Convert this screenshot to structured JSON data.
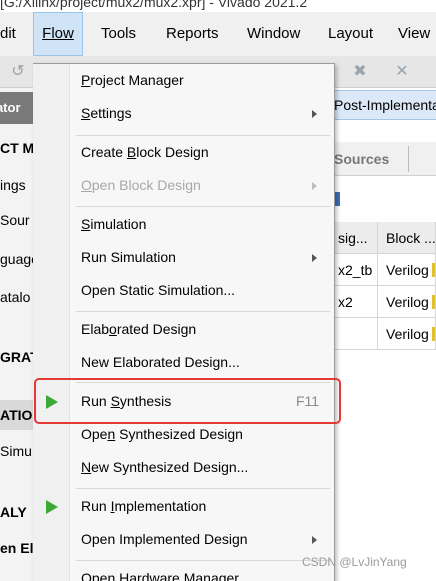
{
  "window": {
    "title": "[G:/Xilinx/project/mux2/mux2.xpr] - Vivado 2021.2"
  },
  "menubar": {
    "items": [
      {
        "label": "dit"
      },
      {
        "label": "Flow",
        "active": true
      },
      {
        "label": "Tools"
      },
      {
        "label": "Reports"
      },
      {
        "label": "Window"
      },
      {
        "label": "Layout"
      },
      {
        "label": "View"
      }
    ]
  },
  "left_panel": {
    "header": "gator",
    "lines": [
      "CT M",
      "ings",
      "Sour",
      "guage",
      "atalo",
      "GRAT",
      "ATIO",
      "Simu",
      "ALY",
      "en El"
    ]
  },
  "right_panel": {
    "banner": "Post-Implementation",
    "tab_label": "Sources",
    "table": {
      "headers": [
        "sig...",
        "Block ..."
      ],
      "rows": [
        [
          "x2_tb",
          "Verilog"
        ],
        [
          "x2",
          "Verilog"
        ],
        [
          "",
          "Verilog"
        ]
      ]
    }
  },
  "flow_menu": {
    "items": [
      {
        "id": "project-manager",
        "label": "Project Manager"
      },
      {
        "id": "settings",
        "label": "Settings",
        "submenu": true
      },
      {
        "id": "create-block-design",
        "label": "Create Block Design"
      },
      {
        "id": "open-block-design",
        "label": "Open Block Design",
        "disabled": true,
        "submenu": true
      },
      {
        "id": "simulation",
        "label": "Simulation"
      },
      {
        "id": "run-simulation",
        "label": "Run Simulation",
        "submenu": true
      },
      {
        "id": "open-static-simulation",
        "label": "Open Static Simulation..."
      },
      {
        "id": "elaborated-design",
        "label": "Elaborated Design"
      },
      {
        "id": "new-elaborated-design",
        "label": "New Elaborated Design..."
      },
      {
        "id": "run-synthesis",
        "label": "Run Synthesis",
        "shortcut": "F11",
        "icon": "play-icon"
      },
      {
        "id": "open-synthesized-design",
        "label": "Open Synthesized Design"
      },
      {
        "id": "new-synthesized-design",
        "label": "New Synthesized Design..."
      },
      {
        "id": "run-implementation",
        "label": "Run Implementation",
        "icon": "play-icon"
      },
      {
        "id": "open-implemented-design",
        "label": "Open Implemented Design",
        "submenu": true
      },
      {
        "id": "open-hardware-manager",
        "label": "Open Hardware Manager"
      }
    ]
  },
  "colors": {
    "accent": "#3aa935",
    "highlight_box": "#e53935",
    "menu_active_bg": "#cfe4f7"
  },
  "watermark": "CSDN @LvJinYang"
}
